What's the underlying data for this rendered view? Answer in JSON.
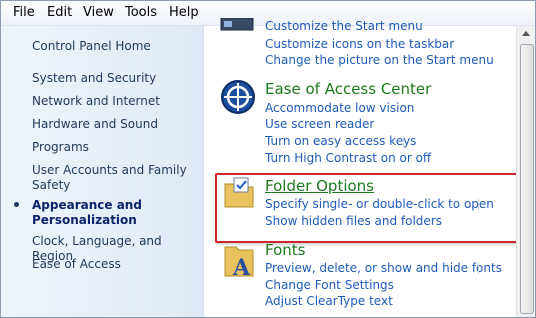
{
  "menu": [
    "File",
    "Edit",
    "View",
    "Tools",
    "Help"
  ],
  "sidebar": {
    "items": [
      "Control Panel Home",
      "System and Security",
      "Network and Internet",
      "Hardware and Sound",
      "Programs",
      "User Accounts and Family Safety",
      "Appearance and Personalization",
      "Clock, Language, and Region",
      "Ease of Access"
    ],
    "current_index": 6
  },
  "sections": [
    {
      "title": "",
      "links": [
        "Customize the Start menu",
        "Customize icons on the taskbar",
        "Change the picture on the Start menu"
      ]
    },
    {
      "title": "Ease of Access Center",
      "links": [
        "Accommodate low vision",
        "Use screen reader",
        "Turn on easy access keys",
        "Turn High Contrast on or off"
      ]
    },
    {
      "title": "Folder Options",
      "links": [
        "Specify single- or double-click to open",
        "Show hidden files and folders"
      ]
    },
    {
      "title": "Fonts",
      "links": [
        "Preview, delete, or show and hide fonts",
        "Change Font Settings",
        "Adjust ClearType text"
      ]
    }
  ],
  "colors": {
    "link": "#1e5bb8",
    "heading": "#1e7a1e",
    "highlight_border": "#cc2a2a"
  }
}
